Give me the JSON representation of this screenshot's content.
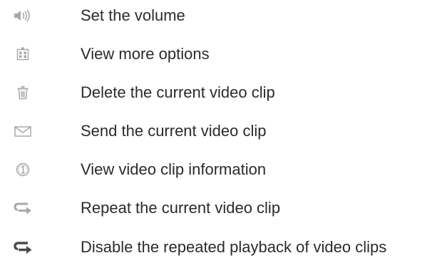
{
  "items": [
    {
      "icon": "volume-icon",
      "label": "Set the volume"
    },
    {
      "icon": "more-options-icon",
      "label": "View more options"
    },
    {
      "icon": "delete-trash-icon",
      "label": "Delete the current video clip"
    },
    {
      "icon": "envelope-send-icon",
      "label": "Send the current video clip"
    },
    {
      "icon": "info-icon",
      "label": "View video clip information"
    },
    {
      "icon": "repeat-icon",
      "label": "Repeat the current video clip"
    },
    {
      "icon": "repeat-disable-icon",
      "label": "Disable the repeated playback of video clips"
    }
  ],
  "colors": {
    "text": "#2b2b2b",
    "icon_light": "#a8a8a8",
    "icon_dark": "#4a4a4a"
  }
}
